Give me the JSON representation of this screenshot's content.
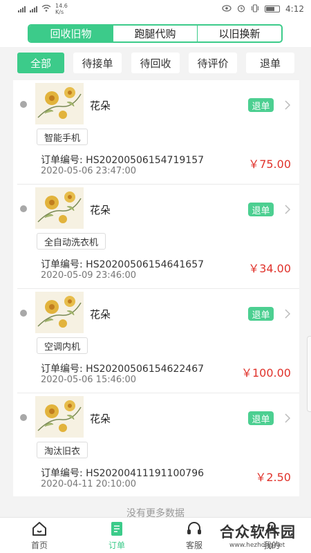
{
  "status_bar": {
    "speed": "14.6",
    "speed_unit": "K/s",
    "time": "4:12"
  },
  "header": {
    "tabs": [
      {
        "label": "回收旧物",
        "active": true
      },
      {
        "label": "跑腿代购",
        "active": false
      },
      {
        "label": "以旧换新",
        "active": false
      }
    ]
  },
  "filters": [
    {
      "label": "全部",
      "active": true
    },
    {
      "label": "待接单",
      "active": false
    },
    {
      "label": "待回收",
      "active": false
    },
    {
      "label": "待评价",
      "active": false
    },
    {
      "label": "退单",
      "active": false
    }
  ],
  "orders": [
    {
      "title": "花朵",
      "badge": "退单",
      "category": "智能手机",
      "order_no": "订单编号: HS20200506154719157",
      "date": "2020-05-06 23:47:00",
      "price": "￥75.00"
    },
    {
      "title": "花朵",
      "badge": "退单",
      "category": "全自动洗衣机",
      "order_no": "订单编号: HS20200506154641657",
      "date": "2020-05-09 23:46:00",
      "price": "￥34.00"
    },
    {
      "title": "花朵",
      "badge": "退单",
      "category": "空调内机",
      "order_no": "订单编号: HS20200506154622467",
      "date": "2020-05-06 15:46:00",
      "price": "￥100.00"
    },
    {
      "title": "花朵",
      "badge": "退单",
      "category": "淘汰旧衣",
      "order_no": "订单编号: HS20200411191100796",
      "date": "2020-04-11 20:10:00",
      "price": "￥2.50"
    }
  ],
  "no_more_text": "没有更多数据",
  "bottom_nav": [
    {
      "label": "首页",
      "icon": "home-icon",
      "active": false
    },
    {
      "label": "订单",
      "icon": "orders-icon",
      "active": true
    },
    {
      "label": "客服",
      "icon": "headset-icon",
      "active": false
    },
    {
      "label": "我的",
      "icon": "user-icon",
      "active": false
    }
  ],
  "watermark": {
    "text": "合众软件园",
    "url": "www.hezhong.net"
  },
  "colors": {
    "accent": "#3ccb8a",
    "price": "#e0322b"
  }
}
